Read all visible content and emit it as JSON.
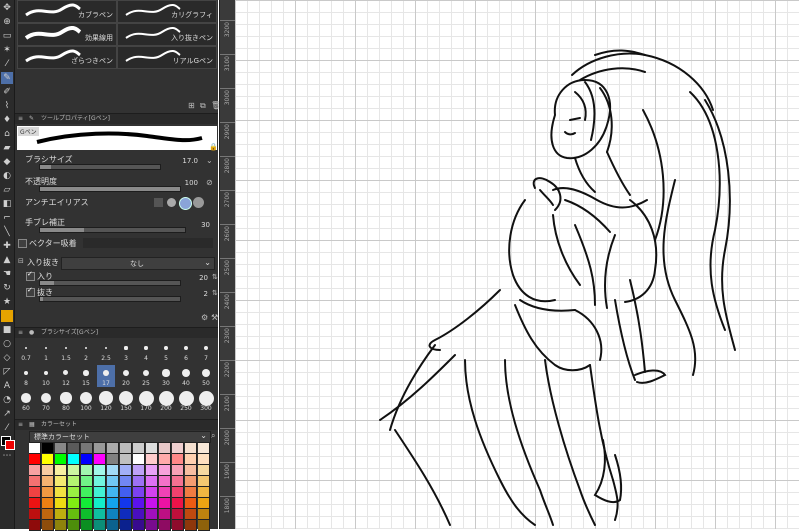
{
  "brushes": [
    {
      "label": "カブラペン"
    },
    {
      "label": "カリグラフィ"
    },
    {
      "label": "効果線用"
    },
    {
      "label": "入り抜きペン"
    },
    {
      "label": "ざらつきペン"
    },
    {
      "label": "リアルGペン"
    }
  ],
  "tool_property": {
    "header": "ツールプロパティ[Gペン]",
    "preview_label": "Gペン",
    "brush_size": {
      "label": "ブラシサイズ",
      "value": "17.0",
      "fraction": 0.09
    },
    "opacity": {
      "label": "不透明度",
      "value": "100",
      "fraction": 1.0
    },
    "antialias": {
      "label": "アンチエイリアス"
    },
    "stabilization": {
      "label": "手ブレ補正",
      "value": "30",
      "fraction": 0.3
    },
    "vector_snap": {
      "label": "ベクター吸着"
    },
    "taper": {
      "label": "入り抜き",
      "select": "なし"
    },
    "taper_in": {
      "label": "入り",
      "value": "20",
      "checked": true
    },
    "taper_out": {
      "label": "抜き",
      "value": "2",
      "checked": true
    }
  },
  "brush_size_panel": {
    "header": "ブラシサイズ[Gペン]",
    "sizes": [
      "0.7",
      "1",
      "1.5",
      "2",
      "2.5",
      "3",
      "4",
      "5",
      "6",
      "7",
      "8",
      "10",
      "12",
      "15",
      "17",
      "20",
      "25",
      "30",
      "40",
      "50",
      "60",
      "70",
      "80",
      "100",
      "120",
      "150",
      "170",
      "200",
      "250",
      "300"
    ],
    "selected": "17"
  },
  "color_set": {
    "header": "カラーセット",
    "set_name": "標準カラーセット"
  },
  "ruler": {
    "numbers": [
      "3200",
      "3100",
      "3000",
      "2900",
      "2800",
      "2700",
      "2600",
      "2500",
      "2400",
      "2300",
      "2200",
      "2100",
      "2000",
      "1900",
      "1800"
    ]
  },
  "icons": {
    "pen_tool": "pen-icon",
    "eraser": "eraser-icon",
    "fill": "bucket-icon",
    "text": "text-icon"
  },
  "colors": {
    "accent": "#4d6fa8",
    "panel": "#323232",
    "grid": "#c9c9c9"
  }
}
